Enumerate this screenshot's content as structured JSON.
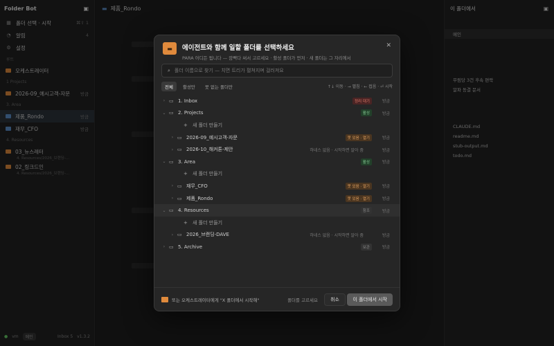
{
  "sidebar": {
    "app_title": "Folder Bot",
    "nav": [
      {
        "label": "폴더 선택 · 시작",
        "kbd": "⌘⇧ 1"
      },
      {
        "label": "알림",
        "count": "4"
      },
      {
        "label": "설정"
      }
    ],
    "sections": {
      "root": "루트",
      "projects": "1 Projects",
      "area": "3. Area",
      "resources": "4. Resources"
    },
    "orchestrator": "오케스트레이터",
    "projects": [
      {
        "label": "2026-09_예시고객-자문",
        "right": "방금"
      }
    ],
    "areas": [
      {
        "label": "제품_Rondo",
        "right": "방금"
      },
      {
        "label": "재무_CFO",
        "right": "방금"
      }
    ],
    "resources": [
      {
        "label": "03_뉴스레터",
        "sub": "4. Resources/2026_브랜딩-..."
      },
      {
        "label": "02_링크드인",
        "sub": "4. Resources/2026_브랜딩-..."
      }
    ],
    "bottom": {
      "vm": "vm",
      "chip": "메인",
      "mid": "Inbox 5",
      "ver": "v1.3.2"
    }
  },
  "main": {
    "title": "제품_Rondo"
  },
  "right": {
    "title": "이 폴더에서",
    "items": [
      "메인",
      "무림당 3건 후속 편락",
      "알파 동결 문서",
      "CLAUDE.md",
      "readme.md",
      "stub-output.md",
      "todo.md"
    ]
  },
  "modal": {
    "title": "에이전트와 함께 일할 폴더를 선택하세요",
    "subtitle": "PARA 어디든 됩니다 — 깜빡다 써서 고르세요 · 활성 폴더가 먼저 · 새 폴더는 그 자리에서",
    "search_placeholder": "폴더 이름으로 찾기 — 치면 트리가 펼쳐지며 걸러져요",
    "filters": [
      "전체",
      "활성만",
      "못 없는 폴더만"
    ],
    "kbd_hint": "↑↓ 이동 · → 펼침 · ← 접음 · ⏎ 시작",
    "select_label": "방금",
    "rows": [
      {
        "name": "1. Inbox",
        "badge": "정리 대기",
        "badge_type": "red",
        "indent": 0,
        "chev": "›",
        "sel": "방금"
      },
      {
        "name": "2. Projects",
        "badge": "활성",
        "badge_type": "green",
        "indent": 0,
        "chev": "⌄",
        "sel": "방금"
      },
      {
        "name": "새 폴더 만들기",
        "indent": 2,
        "new": true
      },
      {
        "name": "2026-09_예시고객-자문",
        "badge": "못 있음 · 열기",
        "badge_type": "orange",
        "indent": 1,
        "chev": "›",
        "sel": "방금"
      },
      {
        "name": "2026-10_해커톤-제안",
        "hint": "하네스 없음 · 시작하면 알아 줌",
        "indent": 1,
        "chev": "›",
        "sel": "방금"
      },
      {
        "name": "3. Area",
        "badge": "활성",
        "badge_type": "green",
        "indent": 0,
        "chev": "⌄",
        "sel": "방금"
      },
      {
        "name": "새 폴더 만들기",
        "indent": 2,
        "new": true
      },
      {
        "name": "재무_CFO",
        "badge": "못 있음 · 열기",
        "badge_type": "orange",
        "indent": 1,
        "chev": "›",
        "sel": "방금"
      },
      {
        "name": "제품_Rondo",
        "badge": "못 있음 · 열기",
        "badge_type": "orange",
        "indent": 1,
        "chev": "›",
        "sel": "방금"
      },
      {
        "name": "4. Resources",
        "badge": "참조",
        "badge_type": "gray",
        "indent": 0,
        "chev": "⌄",
        "sel": "방금",
        "hl": true
      },
      {
        "name": "새 폴더 만들기",
        "indent": 2,
        "new": true
      },
      {
        "name": "2026_브랜딩-DAVE",
        "hint": "하네스 없음 · 시작하면 알아 줌",
        "indent": 1,
        "chev": "›",
        "sel": "방금"
      },
      {
        "name": "5. Archive",
        "badge": "보관",
        "badge_type": "gray",
        "indent": 0,
        "chev": "›",
        "sel": "방금"
      }
    ],
    "footer": {
      "tip": "또는 오케스트레이터에게 \"X 폴더에서 시작해\"",
      "note": "폴더를 고르세요",
      "cancel": "취소",
      "start": "이 폴더에서 시작"
    }
  },
  "colors": {
    "accent": "#e08a3c",
    "bg": "#1c1c1c",
    "modal": "#262626"
  }
}
